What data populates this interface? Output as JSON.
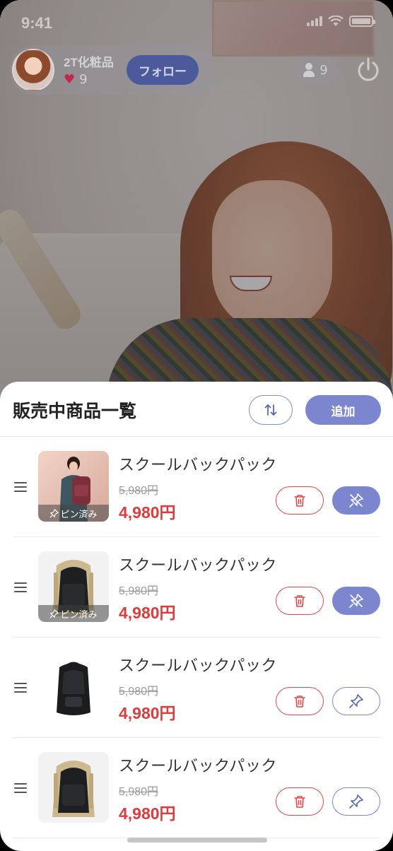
{
  "status_bar": {
    "time": "9:41"
  },
  "host": {
    "name": "2T化粧品",
    "likes": "9",
    "follow_label": "フォロー"
  },
  "viewers": {
    "count": "9"
  },
  "icons": {
    "power": "power-icon",
    "person": "person-icon",
    "heart": "heart-icon",
    "sort": "sort-arrows-icon",
    "trash": "trash-icon",
    "pin": "pin-icon",
    "drag": "drag-handle-icon"
  },
  "colors": {
    "accent": "#7b86cf",
    "price_red": "#e03a3a",
    "delete_red": "#e04848"
  },
  "sheet": {
    "title": "販売中商品一覧",
    "add_label": "追加"
  },
  "products": [
    {
      "name": "スクールバックパック",
      "old_price": "5,980円",
      "price": "4,980円",
      "pinned": true,
      "badge": "ピン済み",
      "image": "model-with-backpack"
    },
    {
      "name": "スクールバックパック",
      "old_price": "5,980円",
      "price": "4,980円",
      "pinned": true,
      "badge": "ピン済み",
      "image": "beige-backpack"
    },
    {
      "name": "スクールバックパック",
      "old_price": "5,980円",
      "price": "4,980円",
      "pinned": false,
      "badge": "",
      "image": "black-backpack"
    },
    {
      "name": "スクールバックパック",
      "old_price": "5,980円",
      "price": "4,980円",
      "pinned": false,
      "badge": "",
      "image": "beige-backpack"
    }
  ]
}
